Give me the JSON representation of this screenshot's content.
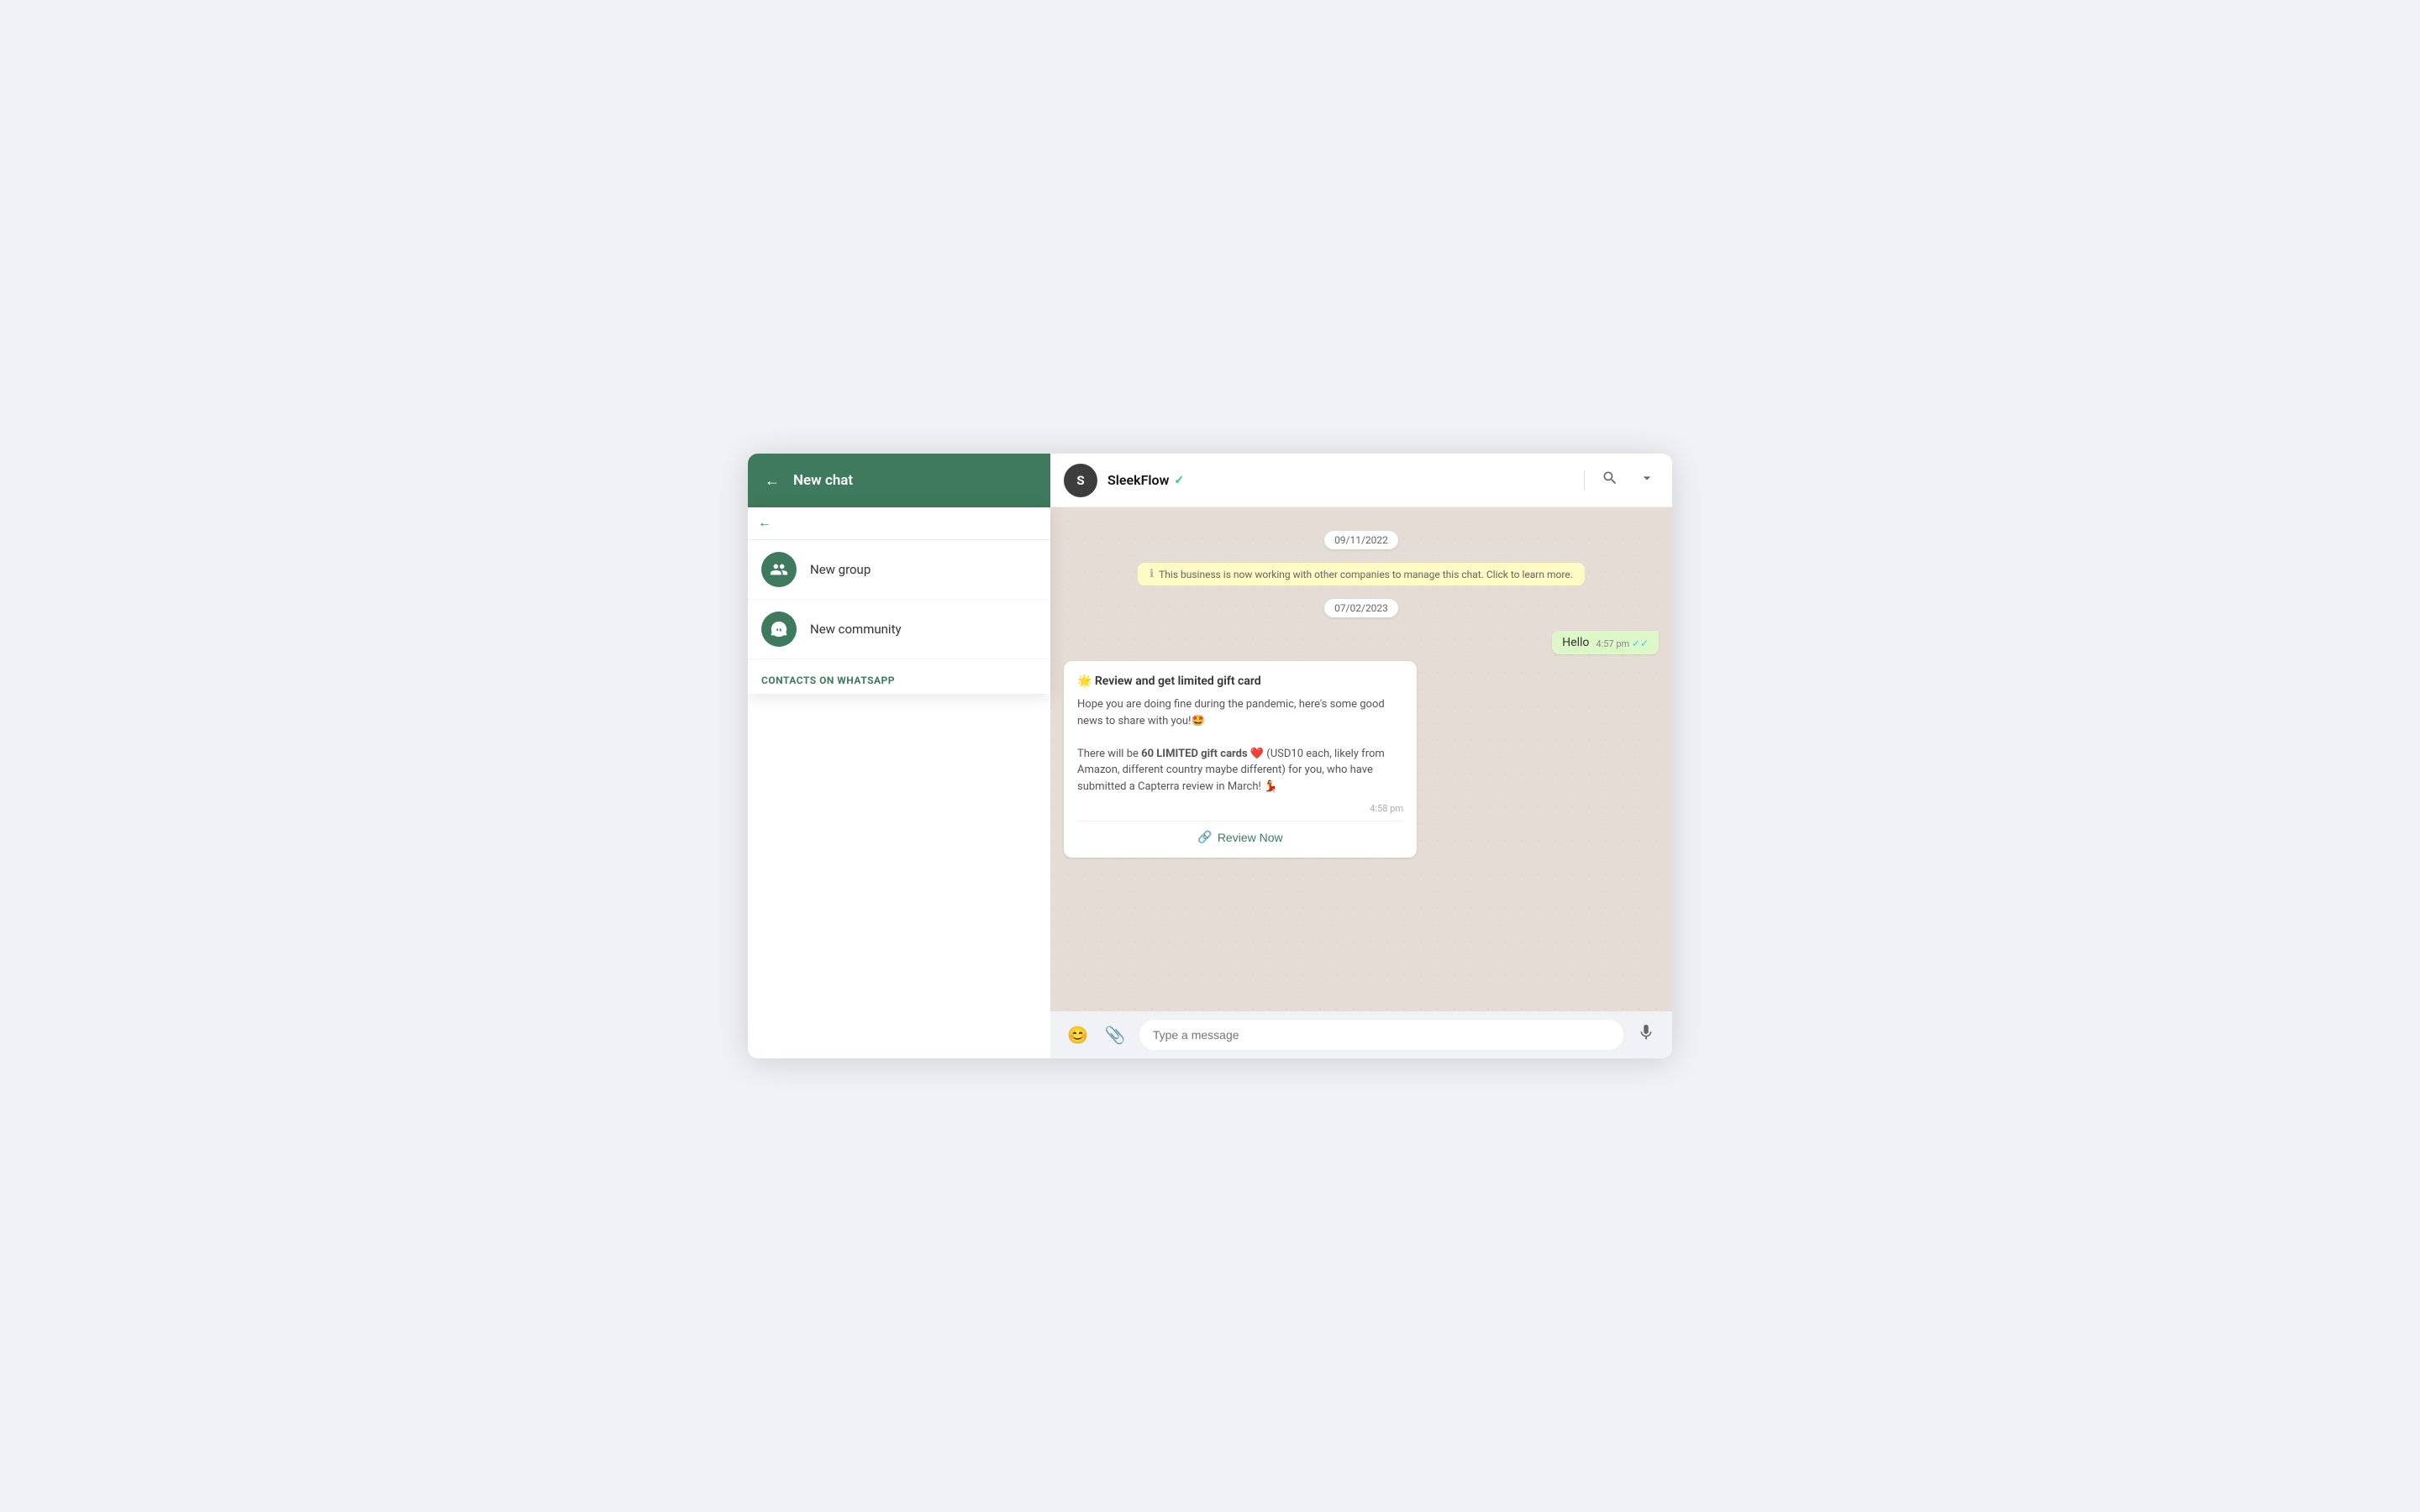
{
  "sidebar": {
    "header": {
      "title": "New chat",
      "back_icon": "←"
    },
    "search": {
      "placeholder": "",
      "back_icon": "←"
    },
    "menu_items": [
      {
        "id": "new-group",
        "label": "New group",
        "icon": "👥"
      },
      {
        "id": "new-community",
        "label": "New community",
        "icon": "👥"
      }
    ],
    "contacts_section": {
      "label": "CONTACTS ON WHATSAPP"
    }
  },
  "chat": {
    "header": {
      "avatar_letter": "S",
      "name": "SleekFlow",
      "verified": true,
      "verified_icon": "✓",
      "search_icon": "🔍",
      "chevron_icon": "▾"
    },
    "messages": [
      {
        "type": "date",
        "value": "09/11/2022"
      },
      {
        "type": "info",
        "value": "This business is now working with other companies to manage this chat. Click to learn more."
      },
      {
        "type": "date",
        "value": "07/02/2023"
      },
      {
        "type": "outgoing",
        "text": "Hello",
        "time": "4:57 pm",
        "read": true
      },
      {
        "type": "card",
        "title": "🌟 Review and get limited gift card",
        "body": "Hope you are doing fine during the pandemic, here's some good news to share with you!🤩\n\nThere will be 60 LIMITED gift cards ❤️ (USD10 each, likely from Amazon, different country maybe different) for you, who have submitted a Capterra review in March! 💃",
        "time": "4:58 pm",
        "action_label": "Review Now",
        "action_icon": "🔗"
      }
    ],
    "input": {
      "placeholder": "Type a message",
      "emoji_icon": "😊",
      "attach_icon": "📎",
      "mic_icon": "🎤"
    }
  }
}
